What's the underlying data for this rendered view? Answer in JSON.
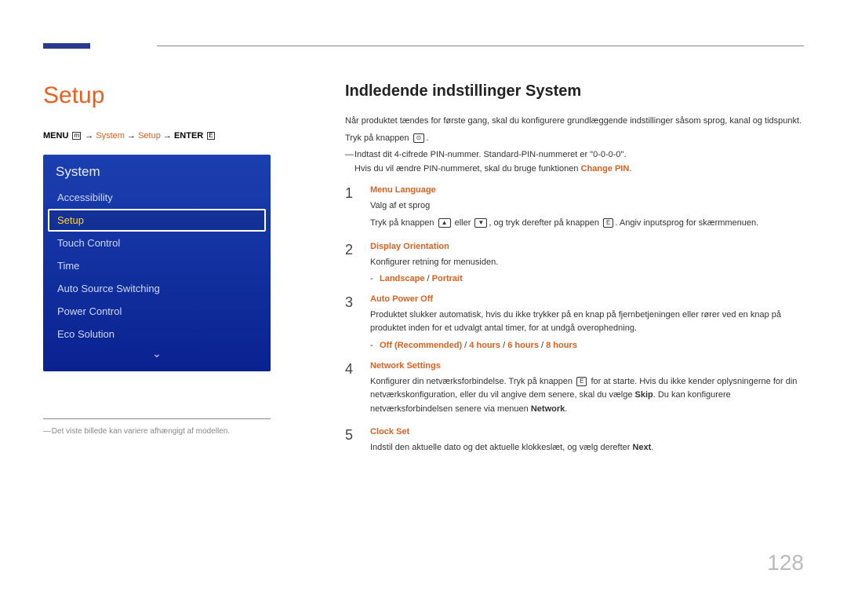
{
  "page_number": "128",
  "left": {
    "title": "Setup",
    "breadcrumb": {
      "prefix": "MENU",
      "menu_icon": "m",
      "arrow": "→",
      "seg1": "System",
      "seg2": "Setup",
      "seg3": "ENTER",
      "enter_icon": "E"
    },
    "menu_header": "System",
    "menu_items": [
      {
        "label": "Accessibility",
        "selected": false
      },
      {
        "label": "Setup",
        "selected": true
      },
      {
        "label": "Touch Control",
        "selected": false
      },
      {
        "label": "Time",
        "selected": false
      },
      {
        "label": "Auto Source Switching",
        "selected": false
      },
      {
        "label": "Power Control",
        "selected": false
      },
      {
        "label": "Eco Solution",
        "selected": false
      }
    ],
    "chevron": "⌄",
    "footnote": "Det viste billede kan variere afhængigt af modellen."
  },
  "right": {
    "section_title": "Indledende indstillinger System",
    "intro": "Når produktet tændes for første gang, skal du konfigurere grundlæggende indstillinger såsom sprog, kanal og tidspunkt.",
    "press_key": "Tryk på knappen",
    "press_key_icon": "⊙",
    "note1": "Indtast dit 4-cifrede PIN-nummer. Standard-PIN-nummeret er \"0-0-0-0\".",
    "note2_a": "Hvis du vil ændre PIN-nummeret, skal du bruge funktionen ",
    "note2_b": "Change PIN",
    "note2_c": ".",
    "steps": [
      {
        "num": "1",
        "heading": "Menu Language",
        "body": [
          {
            "type": "text",
            "text": "Valg af et sprog"
          },
          {
            "type": "keys",
            "prefix": "Tryk på knappen ",
            "k1": "▲",
            "mid": " eller ",
            "k2": "▼",
            "mid2": ", og tryk derefter på knappen ",
            "k3": "E",
            "suffix": ". Angiv inputsprog for skærmmenuen."
          }
        ]
      },
      {
        "num": "2",
        "heading": "Display Orientation",
        "body": [
          {
            "type": "text",
            "text": "Konfigurer retning for menusiden."
          },
          {
            "type": "options",
            "opts": [
              "Landscape",
              "Portrait"
            ]
          }
        ]
      },
      {
        "num": "3",
        "heading": "Auto Power Off",
        "body": [
          {
            "type": "text",
            "text": "Produktet slukker automatisk, hvis du ikke trykker på en knap på fjernbetjeningen eller rører ved en knap på produktet inden for et udvalgt antal timer, for at undgå overophedning."
          },
          {
            "type": "options",
            "opts": [
              "Off (Recommended)",
              "4 hours",
              "6 hours",
              "8 hours"
            ]
          }
        ]
      },
      {
        "num": "4",
        "heading": "Network Settings",
        "body": [
          {
            "type": "rich",
            "pre": "Konfigurer din netværksforbindelse. Tryk på knappen ",
            "key": "E",
            "mid": " for at starte. Hvis du ikke kender oplysningerne for din netværkskonfiguration, eller du vil angive dem senere, skal du vælge ",
            "b1": "Skip",
            "mid2": ". Du kan konfigurere netværksforbindelsen senere via menuen ",
            "b2": "Network",
            "suf": "."
          }
        ]
      },
      {
        "num": "5",
        "heading": "Clock Set",
        "body": [
          {
            "type": "rich2",
            "pre": "Indstil den aktuelle dato og det aktuelle klokkeslæt, og vælg derefter ",
            "b1": "Next",
            "suf": "."
          }
        ]
      }
    ]
  }
}
